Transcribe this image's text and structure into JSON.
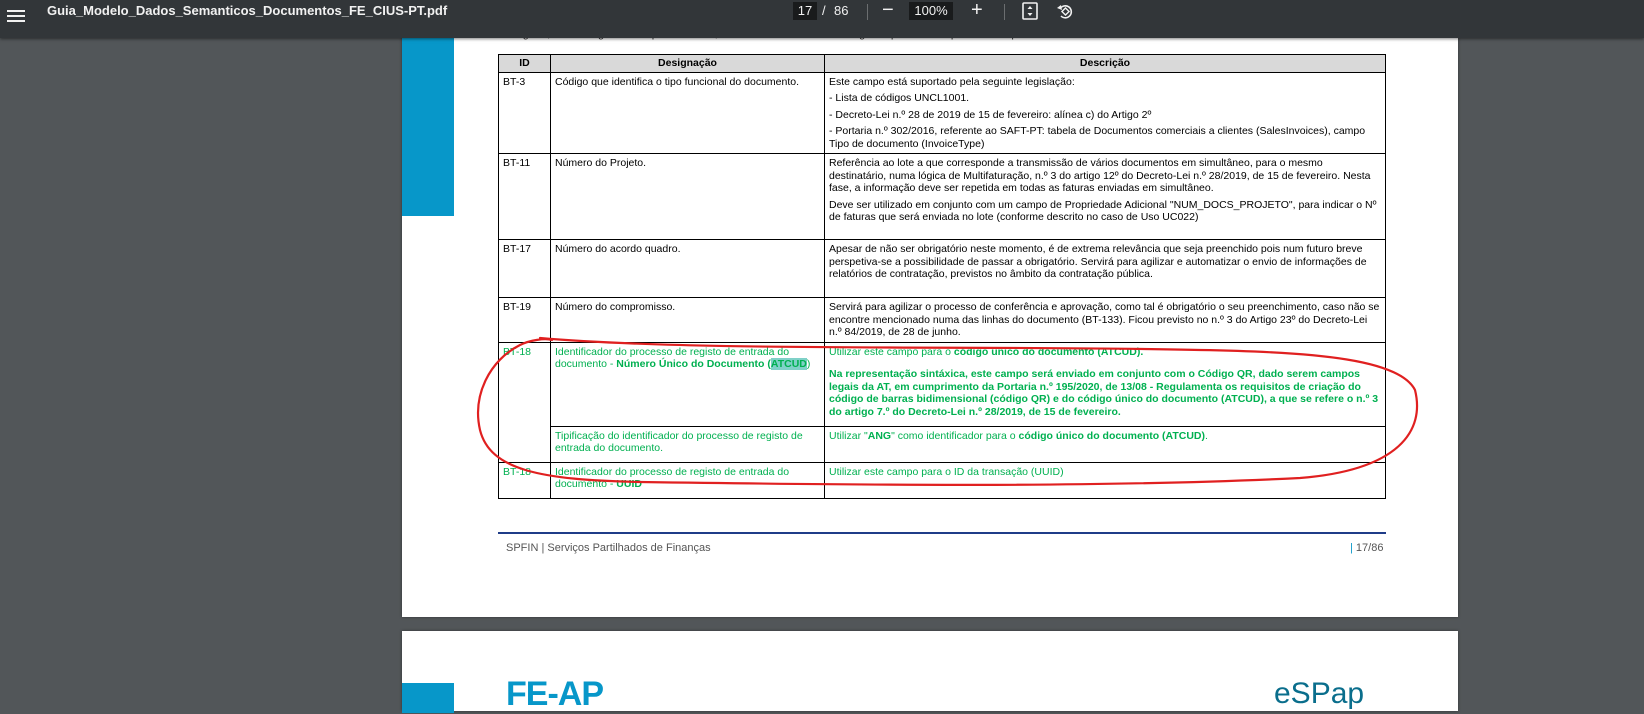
{
  "toolbar": {
    "title": "Guia_Modelo_Dados_Semanticos_Documentos_FE_CIUS-PT.pdf",
    "current_page": "17",
    "page_separator": "/",
    "total_pages": "86",
    "zoom": "100%",
    "zoom_out": "−",
    "zoom_in": "+"
  },
  "page_top_text": "categoria, com o seguinte campo destinado, ainda não se encontra em vigor e que está adaptado o campo:",
  "table": {
    "headers": [
      "ID",
      "Designação",
      "Descrição"
    ],
    "rows": [
      {
        "id": "BT-3",
        "designation": "Código que identifica o tipo funcional do documento.",
        "description": [
          "Este campo está suportado pela seguinte legislação:",
          "- Lista de códigos UNCL1001.",
          "- Decreto-Lei n.º 28 de 2019 de 15 de fevereiro: alínea c) do Artigo 2º",
          "- Portaria n.º 302/2016, referente ao SAFT-PT:  tabela de Documentos comerciais a clientes (SalesInvoices), campo Tipo de documento (InvoiceType)"
        ]
      },
      {
        "id": "BT-11",
        "designation": "Número do Projeto.",
        "description": [
          "Referência ao lote a que corresponde a transmissão de vários documentos em simultâneo, para o mesmo destinatário, numa lógica de Multifaturação, n.º 3 do artigo 12º do Decreto-Lei n.º 28/2019, de 15 de fevereiro. Nesta fase, a informação deve ser repetida em todas as faturas enviadas em simultâneo.",
          "Deve ser utilizado em conjunto com um campo de Propriedade Adicional \"NUM_DOCS_PROJETO\", para indicar o Nº de faturas que será enviada no lote (conforme descrito no caso de Uso UC022)"
        ]
      },
      {
        "id": "BT-17",
        "designation": "Número do acordo quadro.",
        "description": [
          "Apesar de não ser obrigatório neste momento, é de extrema relevância que seja preenchido pois num futuro breve perspetiva-se a possibilidade de passar a obrigatório. Servirá para agilizar e automatizar o envio de informações de relatórios de contratação, previstos no âmbito da contratação pública."
        ]
      },
      {
        "id": "BT-19",
        "designation": "Número do compromisso.",
        "description": [
          "Servirá para agilizar o processo de conferência e aprovação, como tal é obrigatório o seu preenchimento, caso não se encontre mencionado numa das linhas do documento (BT-133). Ficou previsto no n.º 3 do Artigo 23º do Decreto-Lei n.º 84/2019, de 28 de junho."
        ]
      }
    ],
    "green_rows": {
      "bt18_a": {
        "id": "BT-18",
        "designation_pre": "Identificador do processo de registo de entrada do documento - ",
        "designation_bold": "Número Único do Documento (",
        "designation_hl": "ATCUD",
        "designation_post": ")",
        "desc1_pre": "Utilizar este campo para o ",
        "desc1_bold": "código único do documento (ATCUD).",
        "desc2": "Na representação sintáxica, este campo será enviado em conjunto com o Código QR, dado serem campos legais da AT, em cumprimento da Portaria n.º 195/2020, de 13/08  - Regulamenta os requisitos de criação do código de barras bidimensional (código QR) e do código único do documento (ATCUD), a que se refere o n.º 3 do artigo 7.º do Decreto-Lei n.º 28/2019, de 15 de fevereiro.",
        "sub_designation": "Tipificação do identificador do processo de registo de entrada do documento.",
        "sub_desc_pre": "Utilizar \"",
        "sub_desc_bold1": "ANG",
        "sub_desc_mid": "\" como identificador para o ",
        "sub_desc_bold2": "código único do documento (ATCUD)",
        "sub_desc_post": "."
      },
      "bt18_b": {
        "id": "BT-18",
        "designation_pre": "Identificador do processo de registo de entrada do documento - ",
        "designation_bold": "UUID",
        "description": "Utilizar este campo para o ID da transação (UUID)"
      }
    }
  },
  "footer": {
    "left": "SPFIN | Serviços Partilhados de Finanças",
    "right_bar": "|",
    "right": " 17/86"
  },
  "next_page": {
    "logo_left": "FE-AP",
    "logo_right": "eSPap"
  },
  "colors": {
    "toolbar": "#323639",
    "background": "#525659",
    "accent_blue": "#0797c9",
    "green_text": "#00b050",
    "annotation_red": "#e02020"
  }
}
